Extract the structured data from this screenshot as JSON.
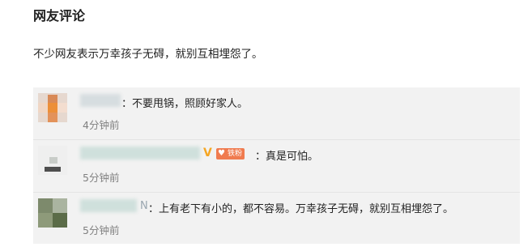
{
  "section_title": "网友评论",
  "intro": "不少网友表示万幸孩子无碍，就别互相埋怨了。",
  "comments": [
    {
      "text": "：不要甩锅，照顾好家人。",
      "time": "4分钟前"
    },
    {
      "text": "：真是可怕。",
      "time": "5分钟前",
      "badge": "铁粉",
      "vip_mark": "V"
    },
    {
      "name_suffix": "N",
      "text": "：上有老下有小的，都不容易。万幸孩子无碍，就别互相埋怨了。",
      "time": "5分钟前"
    }
  ],
  "colors": {
    "background": "#ffffff",
    "comment_background": "#f2f2f2",
    "time_text": "#808080",
    "vip": "#f5a623",
    "badge": "#f07b4f"
  },
  "icons": [
    "user-avatar",
    "vip-icon",
    "fan-heart-icon"
  ]
}
